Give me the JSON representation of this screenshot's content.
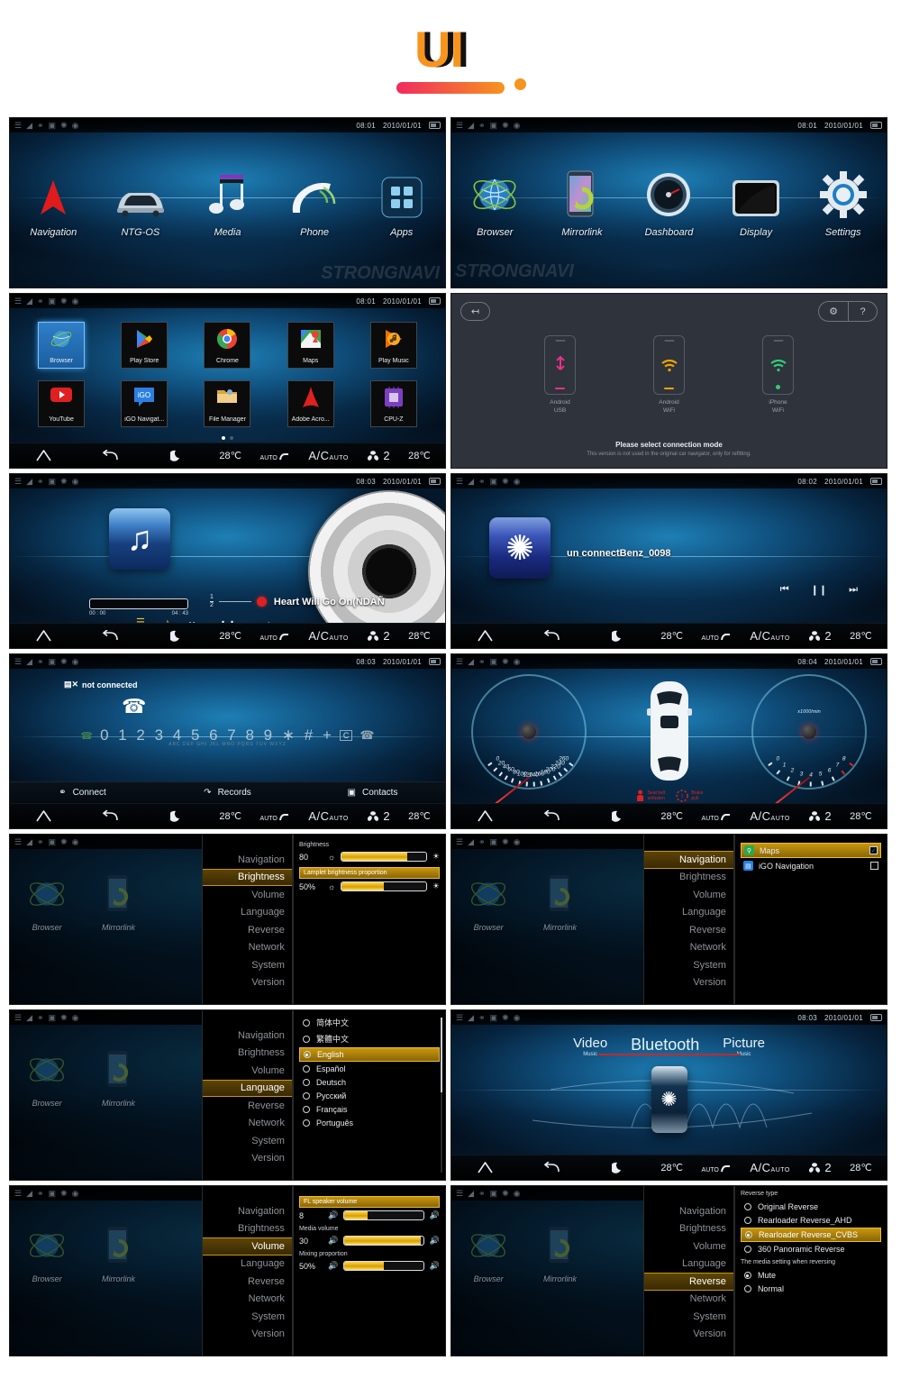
{
  "header": {
    "logo": "UI"
  },
  "statusbar": {
    "icons": [
      "signal-off-icon",
      "wifi-icon",
      "usb-icon",
      "sim-icon",
      "bluetooth-icon",
      "location-icon"
    ],
    "date": "2010/01/01",
    "times": {
      "home": "08:01",
      "apps": "08:01",
      "media": "08:03",
      "bt": "08:02",
      "phone": "08:03",
      "dash": "08:04",
      "source": "08:03"
    }
  },
  "climate": {
    "left_temp": "28℃",
    "auto_label": "AUTO",
    "ac_label": "A/C",
    "ac_sub": "AUTO",
    "fan_level": "2",
    "right_temp": "28℃"
  },
  "navbar": {
    "home": "home-icon",
    "back": "back-icon",
    "night": "night-mode-icon"
  },
  "home1": {
    "items": [
      {
        "label": "Navigation",
        "icon": "navigation-arrow-icon"
      },
      {
        "label": "NTG-OS",
        "icon": "car-icon"
      },
      {
        "label": "Media",
        "icon": "music-note-icon"
      },
      {
        "label": "Phone",
        "icon": "phone-handset-icon"
      },
      {
        "label": "Apps",
        "icon": "apps-grid-icon"
      }
    ]
  },
  "home2": {
    "items": [
      {
        "label": "Browser",
        "icon": "globe-icon"
      },
      {
        "label": "Mirrorlink",
        "icon": "phone-sync-icon"
      },
      {
        "label": "Dashboard",
        "icon": "gauge-icon"
      },
      {
        "label": "Display",
        "icon": "screen-icon"
      },
      {
        "label": "Settings",
        "icon": "gear-icon"
      }
    ]
  },
  "apps": {
    "items": [
      {
        "label": "Browser",
        "icon": "globe-icon",
        "selected": true
      },
      {
        "label": "Play Store",
        "icon": "play-store-icon",
        "selected": false
      },
      {
        "label": "Chrome",
        "icon": "chrome-icon",
        "selected": false
      },
      {
        "label": "Maps",
        "icon": "maps-icon",
        "selected": false
      },
      {
        "label": "Play Music",
        "icon": "play-music-icon",
        "selected": false
      },
      {
        "label": "YouTube",
        "icon": "youtube-icon",
        "selected": false
      },
      {
        "label": "iGO Navigat...",
        "icon": "igo-icon",
        "selected": false
      },
      {
        "label": "File Manager",
        "icon": "file-manager-icon",
        "selected": false
      },
      {
        "label": "Adobe Acro...",
        "icon": "adobe-acrobat-icon",
        "selected": false
      },
      {
        "label": "CPU-Z",
        "icon": "cpuz-icon",
        "selected": false
      }
    ],
    "page_dots": 2,
    "active_dot": 1
  },
  "mirrorlink": {
    "back_icon": "exit-icon",
    "gear_icon": "gear-icon",
    "help_icon": "help-icon",
    "modes": [
      {
        "line1": "Android",
        "line2": "USB",
        "icon": "usb-icon",
        "color": "#e8308a"
      },
      {
        "line1": "Android",
        "line2": "WiFi",
        "icon": "wifi-icon",
        "color": "#f0a500"
      },
      {
        "line1": "iPhone",
        "line2": "WiFi",
        "icon": "wifi-icon",
        "color": "#33cc77"
      }
    ],
    "title": "Please select connection mode",
    "subtitle": "This version is not used in the original car navigator, only for refitting."
  },
  "media_player": {
    "art_icon": "music-note-icon",
    "time_elapsed": "00 : 00",
    "time_total": "04 : 43",
    "track_index": "1",
    "track_total": "2",
    "track_title": "Heart Will Go On(ÑDÀÑ",
    "list_icon": "playlist-icon",
    "search_icon": "lyrics-icon",
    "prev_icon": "previous-icon",
    "pause_icon": "pause-icon",
    "next_icon": "next-icon"
  },
  "bluetooth_audio": {
    "art_icon": "bluetooth-icon",
    "device": "un connectBenz_0098",
    "prev_icon": "previous-icon",
    "pause_icon": "pause-icon",
    "next_icon": "next-icon"
  },
  "phone": {
    "status": "not connected",
    "status_icon": "sim-off-icon",
    "handset_icon": "phone-handset-icon",
    "digits": "0 1 2 3 4 5 6 7 8 9 ∗ # +",
    "clear_key": "C",
    "send_label": "SEND",
    "end_label": "END",
    "keypad_letters": "ABC  DEF  GHI  JKL  MNO PQRS TUV WXYZ",
    "tabs": [
      {
        "label": "Connect",
        "icon": "link-icon"
      },
      {
        "label": "Records",
        "icon": "call-history-icon"
      },
      {
        "label": "Contacts",
        "icon": "contacts-icon"
      }
    ]
  },
  "dashboard": {
    "speedometer": {
      "ticks": [
        "0",
        "20",
        "40",
        "60",
        "80",
        "100",
        "120",
        "140",
        "160",
        "180",
        "200",
        "220",
        "240",
        "260"
      ],
      "value": 0
    },
    "tachometer": {
      "ticks": [
        "0",
        "1",
        "2",
        "3",
        "4",
        "5",
        "6",
        "7",
        "8"
      ],
      "unit": "x1000/min",
      "value": 0,
      "redline_from": 6.5
    },
    "warnings": [
      {
        "line1": "Seat belt",
        "line2": "unfasten",
        "icon": "seatbelt-icon"
      },
      {
        "line1": "Brake",
        "line2": "pull",
        "icon": "brake-icon"
      }
    ],
    "car_icon": "car-top-view-icon"
  },
  "settings": {
    "menu": [
      "Navigation",
      "Brightness",
      "Volume",
      "Language",
      "Reverse",
      "Network",
      "System",
      "Version"
    ],
    "bg_apps": [
      {
        "label": "Browser",
        "icon": "globe-icon"
      },
      {
        "label": "Mirrorlink",
        "icon": "phone-sync-icon"
      }
    ],
    "brightness": {
      "active": "Brightness",
      "label": "Brightness",
      "value": "80",
      "fill_pct": 78,
      "highlight": "Lamplet brightness proportion",
      "value2": "50%",
      "fill2_pct": 50,
      "low_icon": "brightness-low-icon",
      "high_icon": "brightness-high-icon"
    },
    "navigation": {
      "active": "Navigation",
      "apps": [
        {
          "label": "Maps",
          "icon": "maps-icon",
          "checked": true,
          "color": "#2aa84f"
        },
        {
          "label": "iGO Navigation",
          "icon": "igo-icon",
          "checked": false,
          "color": "#2b7fe0"
        }
      ],
      "check_mark": "✓"
    },
    "language": {
      "active": "Language",
      "options": [
        {
          "label": "简体中文",
          "selected": false
        },
        {
          "label": "繁體中文",
          "selected": false
        },
        {
          "label": "English",
          "selected": true
        },
        {
          "label": "Español",
          "selected": false
        },
        {
          "label": "Deutsch",
          "selected": false
        },
        {
          "label": "Русский",
          "selected": false
        },
        {
          "label": "Français",
          "selected": false
        },
        {
          "label": "Português",
          "selected": false
        }
      ]
    },
    "volume": {
      "active": "Volume",
      "label1": "FL speaker volume",
      "value1": "8",
      "fill1_pct": 30,
      "label2": "Media volume",
      "value2": "30",
      "fill2_pct": 97,
      "label3": "Mixing proportion",
      "value3": "50%",
      "fill3_pct": 50,
      "vol_icon": "volume-icon"
    },
    "reverse": {
      "active": "Reverse",
      "type_label": "Reverse type",
      "types": [
        {
          "label": "Original Reverse",
          "selected": false
        },
        {
          "label": "Rearloader Reverse_AHD",
          "selected": false
        },
        {
          "label": "Rearloader Reverse_CVBS",
          "selected": true
        },
        {
          "label": "360 Panoramic Reverse",
          "selected": false
        }
      ],
      "media_label": "The media setting when reversing",
      "media_options": [
        {
          "label": "Mute",
          "selected": true
        },
        {
          "label": "Normal",
          "selected": false
        }
      ]
    }
  },
  "media_source": {
    "items": [
      {
        "big": "Video",
        "small": "Music",
        "active": false
      },
      {
        "big": "Bluetooth",
        "small": "",
        "active": true
      },
      {
        "big": "Picture",
        "small": "Music",
        "active": false
      }
    ],
    "device_icon": "bluetooth-icon"
  },
  "watermark": "STRONGNAVI",
  "colors": {
    "accent_gold": "#c8960e",
    "accent_gold_light": "#ffd84d",
    "screen_blue": "#1e7fb5",
    "red": "#e02020"
  }
}
